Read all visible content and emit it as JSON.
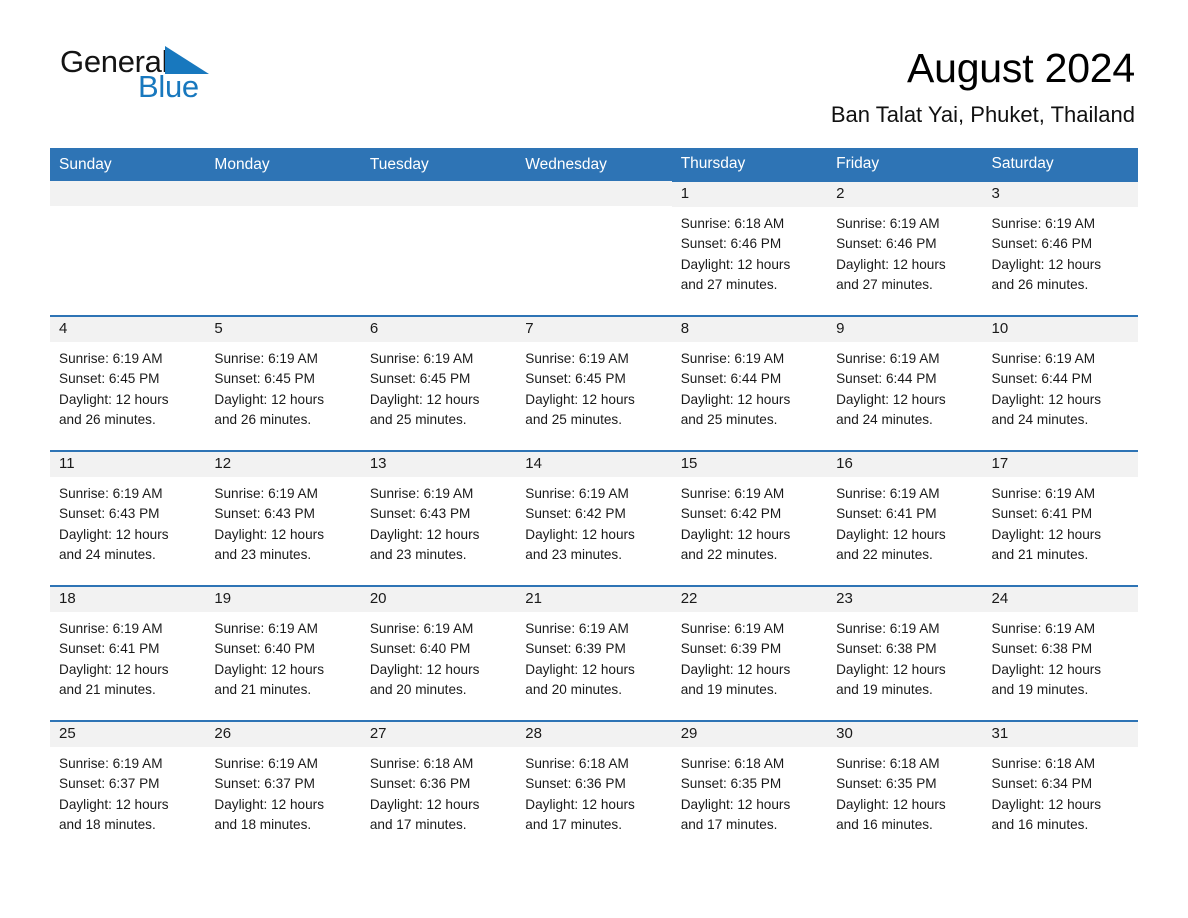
{
  "brand": {
    "name_part1": "General",
    "name_part2": "Blue",
    "logo_icon": "triangle-logo-icon",
    "accent_color": "#1878be"
  },
  "header": {
    "title": "August 2024",
    "location": "Ban Talat Yai, Phuket, Thailand"
  },
  "theme": {
    "header_blue": "#2e74b5",
    "daynum_gray": "#f2f2f2",
    "text_black": "#1a1a1a"
  },
  "calendar": {
    "weekday_headers": [
      "Sunday",
      "Monday",
      "Tuesday",
      "Wednesday",
      "Thursday",
      "Friday",
      "Saturday"
    ],
    "weeks": [
      [
        {
          "day": "",
          "sunrise": "",
          "sunset": "",
          "daylight_line1": "",
          "daylight_line2": ""
        },
        {
          "day": "",
          "sunrise": "",
          "sunset": "",
          "daylight_line1": "",
          "daylight_line2": ""
        },
        {
          "day": "",
          "sunrise": "",
          "sunset": "",
          "daylight_line1": "",
          "daylight_line2": ""
        },
        {
          "day": "",
          "sunrise": "",
          "sunset": "",
          "daylight_line1": "",
          "daylight_line2": ""
        },
        {
          "day": "1",
          "sunrise": "Sunrise: 6:18 AM",
          "sunset": "Sunset: 6:46 PM",
          "daylight_line1": "Daylight: 12 hours",
          "daylight_line2": "and 27 minutes."
        },
        {
          "day": "2",
          "sunrise": "Sunrise: 6:19 AM",
          "sunset": "Sunset: 6:46 PM",
          "daylight_line1": "Daylight: 12 hours",
          "daylight_line2": "and 27 minutes."
        },
        {
          "day": "3",
          "sunrise": "Sunrise: 6:19 AM",
          "sunset": "Sunset: 6:46 PM",
          "daylight_line1": "Daylight: 12 hours",
          "daylight_line2": "and 26 minutes."
        }
      ],
      [
        {
          "day": "4",
          "sunrise": "Sunrise: 6:19 AM",
          "sunset": "Sunset: 6:45 PM",
          "daylight_line1": "Daylight: 12 hours",
          "daylight_line2": "and 26 minutes."
        },
        {
          "day": "5",
          "sunrise": "Sunrise: 6:19 AM",
          "sunset": "Sunset: 6:45 PM",
          "daylight_line1": "Daylight: 12 hours",
          "daylight_line2": "and 26 minutes."
        },
        {
          "day": "6",
          "sunrise": "Sunrise: 6:19 AM",
          "sunset": "Sunset: 6:45 PM",
          "daylight_line1": "Daylight: 12 hours",
          "daylight_line2": "and 25 minutes."
        },
        {
          "day": "7",
          "sunrise": "Sunrise: 6:19 AM",
          "sunset": "Sunset: 6:45 PM",
          "daylight_line1": "Daylight: 12 hours",
          "daylight_line2": "and 25 minutes."
        },
        {
          "day": "8",
          "sunrise": "Sunrise: 6:19 AM",
          "sunset": "Sunset: 6:44 PM",
          "daylight_line1": "Daylight: 12 hours",
          "daylight_line2": "and 25 minutes."
        },
        {
          "day": "9",
          "sunrise": "Sunrise: 6:19 AM",
          "sunset": "Sunset: 6:44 PM",
          "daylight_line1": "Daylight: 12 hours",
          "daylight_line2": "and 24 minutes."
        },
        {
          "day": "10",
          "sunrise": "Sunrise: 6:19 AM",
          "sunset": "Sunset: 6:44 PM",
          "daylight_line1": "Daylight: 12 hours",
          "daylight_line2": "and 24 minutes."
        }
      ],
      [
        {
          "day": "11",
          "sunrise": "Sunrise: 6:19 AM",
          "sunset": "Sunset: 6:43 PM",
          "daylight_line1": "Daylight: 12 hours",
          "daylight_line2": "and 24 minutes."
        },
        {
          "day": "12",
          "sunrise": "Sunrise: 6:19 AM",
          "sunset": "Sunset: 6:43 PM",
          "daylight_line1": "Daylight: 12 hours",
          "daylight_line2": "and 23 minutes."
        },
        {
          "day": "13",
          "sunrise": "Sunrise: 6:19 AM",
          "sunset": "Sunset: 6:43 PM",
          "daylight_line1": "Daylight: 12 hours",
          "daylight_line2": "and 23 minutes."
        },
        {
          "day": "14",
          "sunrise": "Sunrise: 6:19 AM",
          "sunset": "Sunset: 6:42 PM",
          "daylight_line1": "Daylight: 12 hours",
          "daylight_line2": "and 23 minutes."
        },
        {
          "day": "15",
          "sunrise": "Sunrise: 6:19 AM",
          "sunset": "Sunset: 6:42 PM",
          "daylight_line1": "Daylight: 12 hours",
          "daylight_line2": "and 22 minutes."
        },
        {
          "day": "16",
          "sunrise": "Sunrise: 6:19 AM",
          "sunset": "Sunset: 6:41 PM",
          "daylight_line1": "Daylight: 12 hours",
          "daylight_line2": "and 22 minutes."
        },
        {
          "day": "17",
          "sunrise": "Sunrise: 6:19 AM",
          "sunset": "Sunset: 6:41 PM",
          "daylight_line1": "Daylight: 12 hours",
          "daylight_line2": "and 21 minutes."
        }
      ],
      [
        {
          "day": "18",
          "sunrise": "Sunrise: 6:19 AM",
          "sunset": "Sunset: 6:41 PM",
          "daylight_line1": "Daylight: 12 hours",
          "daylight_line2": "and 21 minutes."
        },
        {
          "day": "19",
          "sunrise": "Sunrise: 6:19 AM",
          "sunset": "Sunset: 6:40 PM",
          "daylight_line1": "Daylight: 12 hours",
          "daylight_line2": "and 21 minutes."
        },
        {
          "day": "20",
          "sunrise": "Sunrise: 6:19 AM",
          "sunset": "Sunset: 6:40 PM",
          "daylight_line1": "Daylight: 12 hours",
          "daylight_line2": "and 20 minutes."
        },
        {
          "day": "21",
          "sunrise": "Sunrise: 6:19 AM",
          "sunset": "Sunset: 6:39 PM",
          "daylight_line1": "Daylight: 12 hours",
          "daylight_line2": "and 20 minutes."
        },
        {
          "day": "22",
          "sunrise": "Sunrise: 6:19 AM",
          "sunset": "Sunset: 6:39 PM",
          "daylight_line1": "Daylight: 12 hours",
          "daylight_line2": "and 19 minutes."
        },
        {
          "day": "23",
          "sunrise": "Sunrise: 6:19 AM",
          "sunset": "Sunset: 6:38 PM",
          "daylight_line1": "Daylight: 12 hours",
          "daylight_line2": "and 19 minutes."
        },
        {
          "day": "24",
          "sunrise": "Sunrise: 6:19 AM",
          "sunset": "Sunset: 6:38 PM",
          "daylight_line1": "Daylight: 12 hours",
          "daylight_line2": "and 19 minutes."
        }
      ],
      [
        {
          "day": "25",
          "sunrise": "Sunrise: 6:19 AM",
          "sunset": "Sunset: 6:37 PM",
          "daylight_line1": "Daylight: 12 hours",
          "daylight_line2": "and 18 minutes."
        },
        {
          "day": "26",
          "sunrise": "Sunrise: 6:19 AM",
          "sunset": "Sunset: 6:37 PM",
          "daylight_line1": "Daylight: 12 hours",
          "daylight_line2": "and 18 minutes."
        },
        {
          "day": "27",
          "sunrise": "Sunrise: 6:18 AM",
          "sunset": "Sunset: 6:36 PM",
          "daylight_line1": "Daylight: 12 hours",
          "daylight_line2": "and 17 minutes."
        },
        {
          "day": "28",
          "sunrise": "Sunrise: 6:18 AM",
          "sunset": "Sunset: 6:36 PM",
          "daylight_line1": "Daylight: 12 hours",
          "daylight_line2": "and 17 minutes."
        },
        {
          "day": "29",
          "sunrise": "Sunrise: 6:18 AM",
          "sunset": "Sunset: 6:35 PM",
          "daylight_line1": "Daylight: 12 hours",
          "daylight_line2": "and 17 minutes."
        },
        {
          "day": "30",
          "sunrise": "Sunrise: 6:18 AM",
          "sunset": "Sunset: 6:35 PM",
          "daylight_line1": "Daylight: 12 hours",
          "daylight_line2": "and 16 minutes."
        },
        {
          "day": "31",
          "sunrise": "Sunrise: 6:18 AM",
          "sunset": "Sunset: 6:34 PM",
          "daylight_line1": "Daylight: 12 hours",
          "daylight_line2": "and 16 minutes."
        }
      ]
    ]
  }
}
